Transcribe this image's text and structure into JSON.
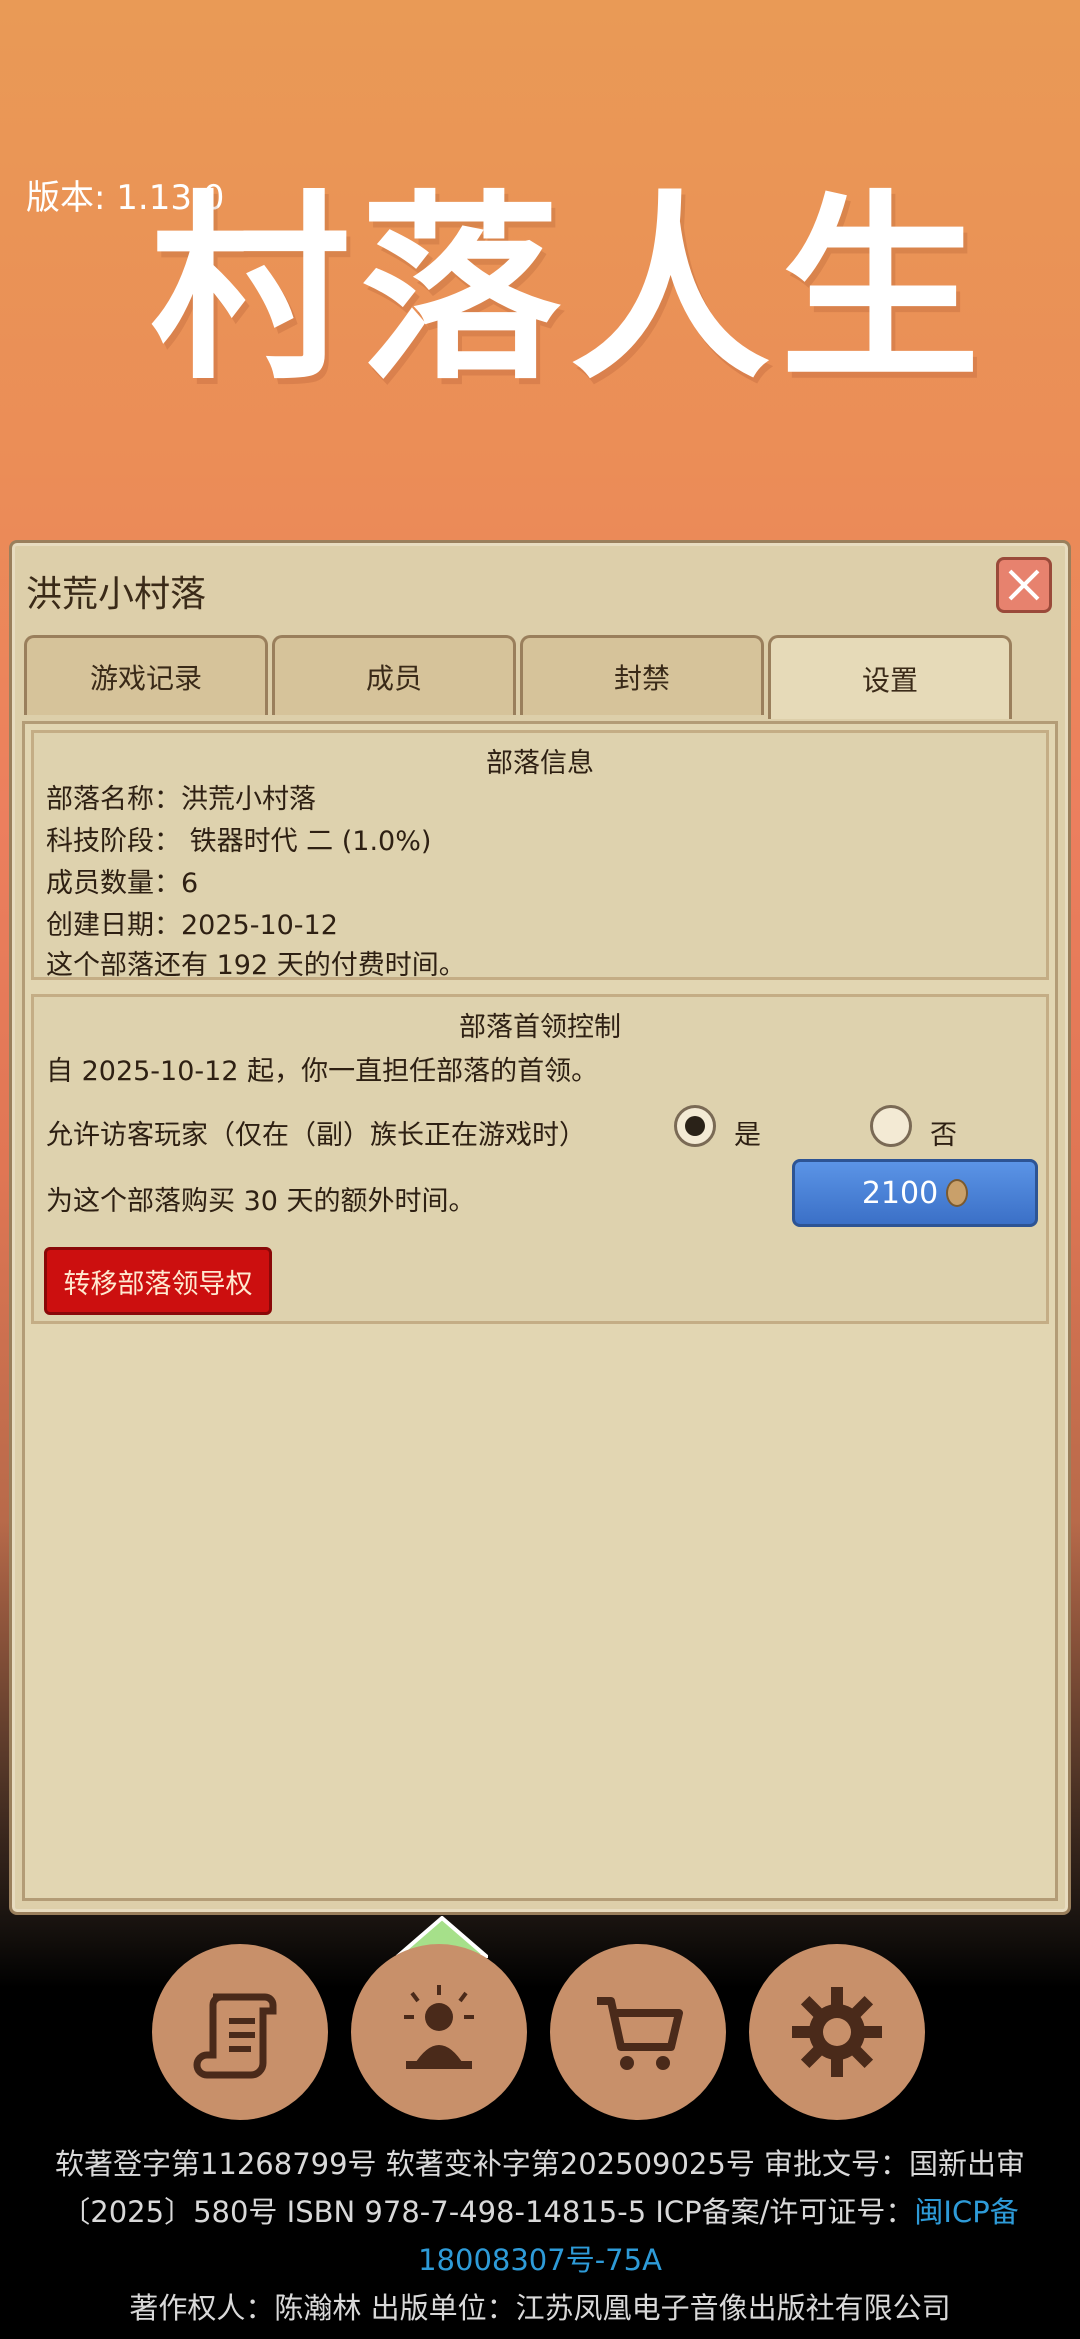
{
  "header": {
    "version_label": "版本: 1.13.0",
    "logo_text": "村落人生"
  },
  "panel": {
    "title": "洪荒小村落",
    "tabs": [
      {
        "label": "游戏记录"
      },
      {
        "label": "成员"
      },
      {
        "label": "封禁"
      },
      {
        "label": "设置"
      }
    ],
    "active_tab": "设置",
    "tribe_info": {
      "title": "部落信息",
      "name_line": "部落名称：洪荒小村落",
      "tech_line": "科技阶段： 铁器时代 二 (1.0%)",
      "members_line": "成员数量：6",
      "created_line": "创建日期：2025-10-12",
      "paid_time_line": "这个部落还有 192 天的付费时间。"
    },
    "leader_control": {
      "title": "部落首领控制",
      "since_line": "自 2025-10-12 起，你一直担任部落的首领。",
      "visitor_label": "允许访客玩家（仅在（副）族长正在游戏时）",
      "yes_label": "是",
      "no_label": "否",
      "visitor_allowed": true,
      "buy_label": "为这个部落购买 30 天的额外时间。",
      "buy_price": "2100",
      "transfer_label": "转移部落领导权"
    }
  },
  "nav": {
    "items": [
      "scroll-icon",
      "meditation-icon",
      "cart-icon",
      "gear-icon"
    ]
  },
  "footer": {
    "line1": "软著登字第11268799号 软著变补字第202509025号 审批文号：国新出审",
    "line2_prefix": "〔2025〕580号 ISBN 978-7-498-14815-5 ICP备案/许可证号：",
    "line2_link": "闽ICP备",
    "line3_link": "18008307号-75A",
    "line4": "著作权人：陈瀚林 出版单位：江苏凤凰电子音像出版社有限公司"
  },
  "colors": {
    "panel_bg": "#ddcfaa",
    "buy_button": "#4a82d8",
    "transfer_button": "#cc0f0f",
    "link": "#2e9bd8"
  }
}
